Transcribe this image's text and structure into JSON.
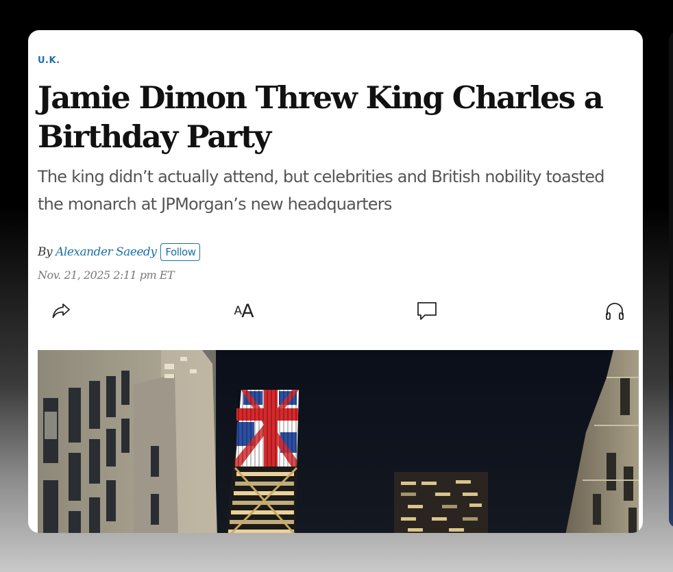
{
  "article": {
    "section": "U.K.",
    "headline": "Jamie Dimon Threw King Charles a Birthday Party",
    "dek": "The king didn’t actually attend, but celebrities and British nobility toasted the monarch at JPMorgan’s new headquarters",
    "byline_prefix": "By",
    "author": "Alexander Saeedy",
    "follow_label": "Follow",
    "timestamp": "Nov. 21, 2025 2:11 pm ET"
  },
  "toolbar": {
    "share_icon": "share-icon",
    "text_size_small": "A",
    "text_size_large": "A",
    "comments_icon": "comment-icon",
    "listen_icon": "headphones-icon"
  },
  "colors": {
    "accent": "#1a6fa8",
    "headline": "#111111",
    "dek": "#555555",
    "timestamp": "#777777"
  }
}
